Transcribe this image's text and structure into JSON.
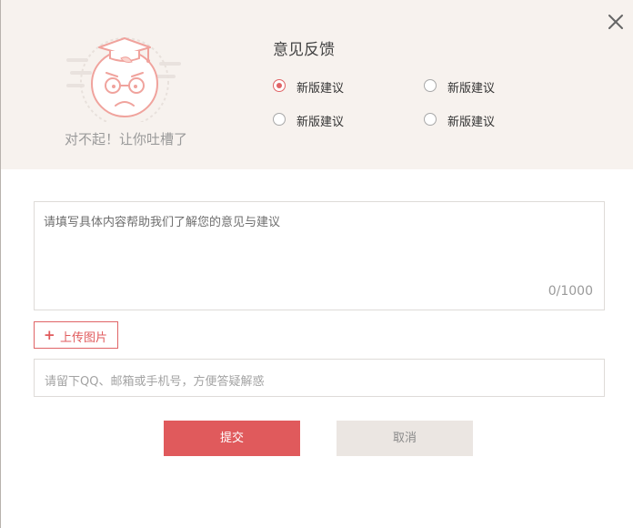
{
  "header": {
    "sorry_text": "对不起！让你吐槽了",
    "title": "意见反馈",
    "close_icon": "close-icon"
  },
  "options": [
    {
      "label": "新版建议",
      "checked": true
    },
    {
      "label": "新版建议",
      "checked": false
    },
    {
      "label": "新版建议",
      "checked": false
    },
    {
      "label": "新版建议",
      "checked": false
    }
  ],
  "feedback": {
    "placeholder": "请填写具体内容帮助我们了解您的意见与建议",
    "char_count": "0/1000"
  },
  "upload": {
    "icon": "+",
    "label": "上传图片"
  },
  "contact": {
    "placeholder": "请留下QQ、邮箱或手机号，方便答疑解惑"
  },
  "buttons": {
    "submit": "提交",
    "cancel": "取消"
  },
  "colors": {
    "accent": "#e05a5c",
    "header_bg": "#f7f2ee",
    "cancel_bg": "#ebe6e2"
  }
}
